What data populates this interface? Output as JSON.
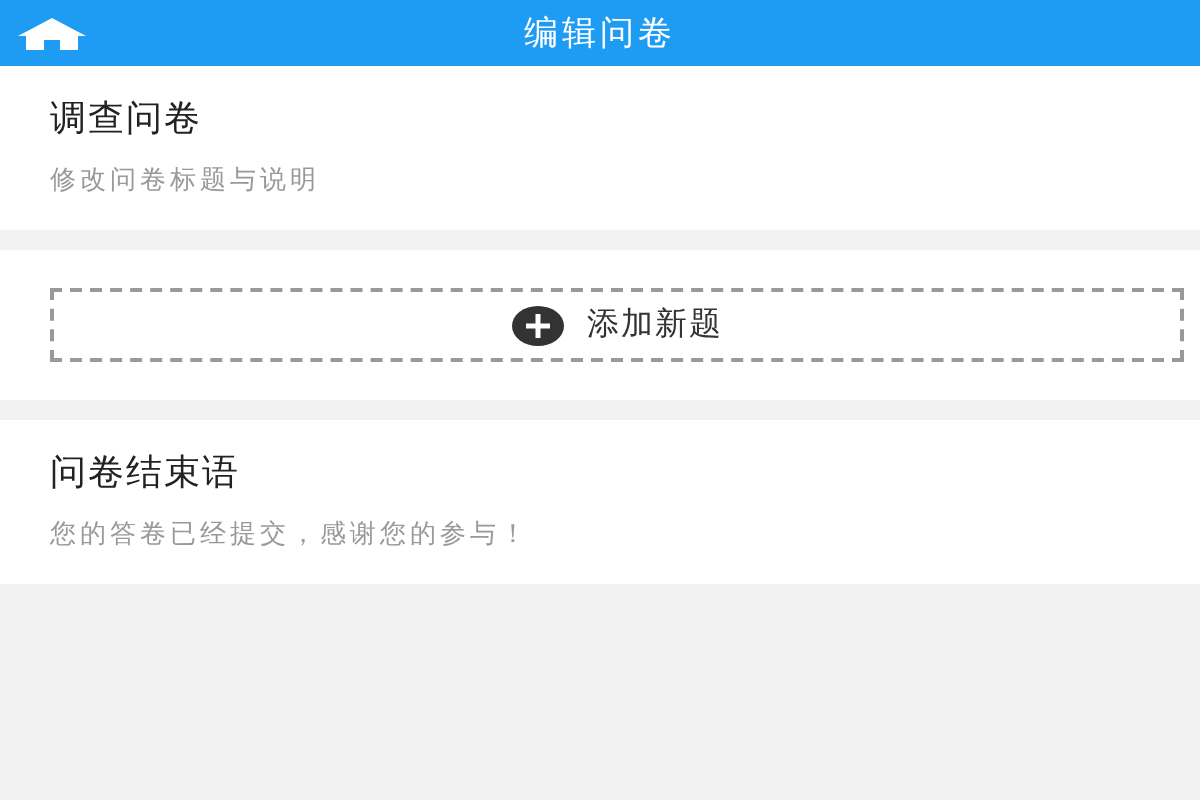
{
  "header": {
    "title": "编辑问卷"
  },
  "survey": {
    "title": "调查问卷",
    "subtitle": "修改问卷标题与说明"
  },
  "add_question": {
    "label": "添加新题"
  },
  "closing": {
    "title": "问卷结束语",
    "subtitle": "您的答卷已经提交，感谢您的参与！"
  }
}
